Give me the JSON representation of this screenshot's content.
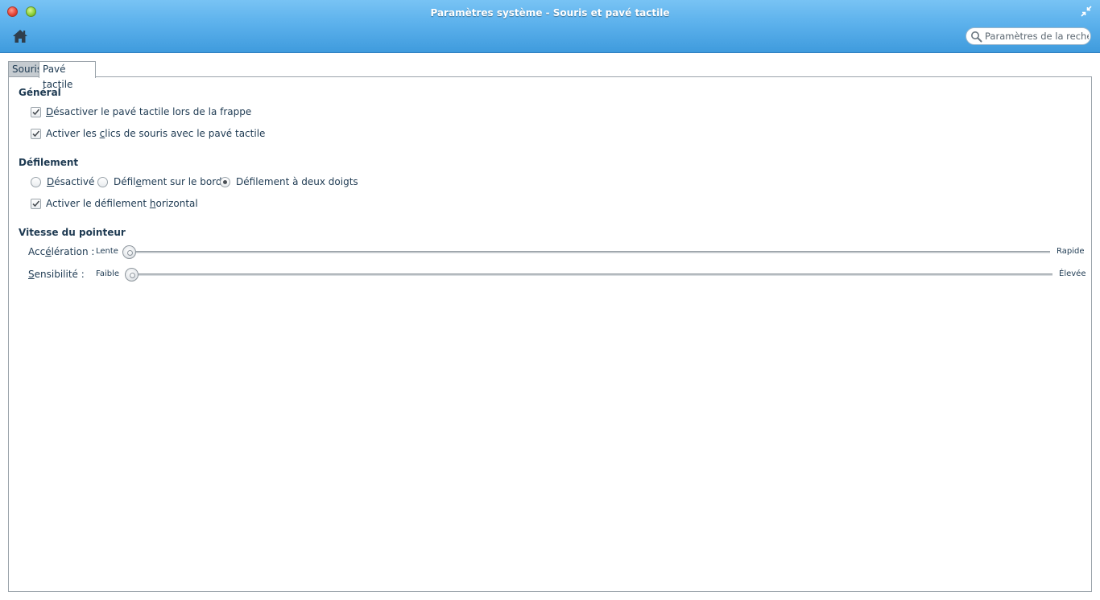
{
  "window": {
    "title": "Paramètres système - Souris et pavé tactile"
  },
  "toolbar": {
    "home_icon": "home-icon",
    "search": {
      "placeholder": "Paramètres de la recher",
      "value": ""
    }
  },
  "tabs": [
    {
      "label": "Souris",
      "active": false
    },
    {
      "label": "Pavé tactile",
      "active": true
    }
  ],
  "general": {
    "title": "Général",
    "options": [
      {
        "pre": "",
        "ul": "D",
        "post": "ésactiver le pavé tactile lors de la frappe",
        "checked": true
      },
      {
        "pre": "Activer les ",
        "ul": "c",
        "post": "lics de souris avec le pavé tactile",
        "checked": true
      }
    ]
  },
  "scrolling": {
    "title": "Défilement",
    "radios": [
      {
        "pre": "",
        "ul": "D",
        "post": "ésactivé",
        "selected": false
      },
      {
        "pre": "Défil",
        "ul": "e",
        "post": "ment sur le bord",
        "selected": false
      },
      {
        "pre": "Déf",
        "ul": "i",
        "post": "lement à deux doigts",
        "selected": true
      }
    ],
    "horizontal": {
      "pre": "Activer le défilement ",
      "ul": "h",
      "post": "orizontal",
      "checked": true
    }
  },
  "pointer_speed": {
    "title": "Vitesse du pointeur",
    "acceleration": {
      "label_pre": "Acc",
      "label_ul": "é",
      "label_post": "lération :",
      "min_label": "Lente",
      "max_label": "Rapide",
      "level": 0.0
    },
    "sensitivity": {
      "label_pre": "",
      "label_ul": "S",
      "label_post": "ensibilité :",
      "min_label": "Faible",
      "max_label": "Élevée",
      "level": 0.0
    }
  },
  "colors": {
    "header_top": "#78c3f4",
    "header_bottom": "#3f9bdd",
    "text": "#1e3a52"
  }
}
